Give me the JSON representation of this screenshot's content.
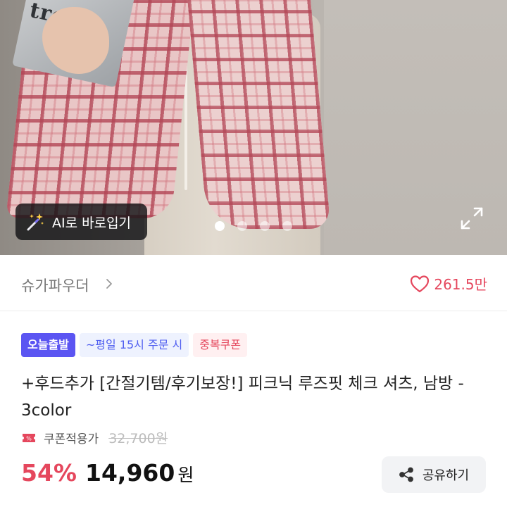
{
  "hero": {
    "ai_button_label": "AI로 바로입기",
    "box_text": "tro",
    "carousel": {
      "total": 4,
      "active": 1
    }
  },
  "brand": {
    "name": "슈가파우더",
    "like_count": "261.5만"
  },
  "badges": {
    "today": "오늘출발",
    "time": "~평일 15시 주문 시",
    "coupon": "중복쿠폰"
  },
  "product": {
    "title": "+후드추가 [간절기템/후기보장!] 피크닉 루즈핏 체크 셔츠, 남방 - 3color"
  },
  "pricing": {
    "coupon_label": "쿠폰적용가",
    "original_price": "32,700원",
    "discount_rate": "54%",
    "sale_price": "14,960",
    "unit": "원"
  },
  "actions": {
    "share_label": "공유하기"
  },
  "colors": {
    "accent_red": "#e5475d",
    "badge_purple": "#5b55f2",
    "badge_blue_text": "#4f5ef0"
  },
  "icons": [
    "magic-wand-icon",
    "expand-icon",
    "chevron-right-icon",
    "heart-icon",
    "coupon-ticket-icon",
    "share-icon"
  ]
}
